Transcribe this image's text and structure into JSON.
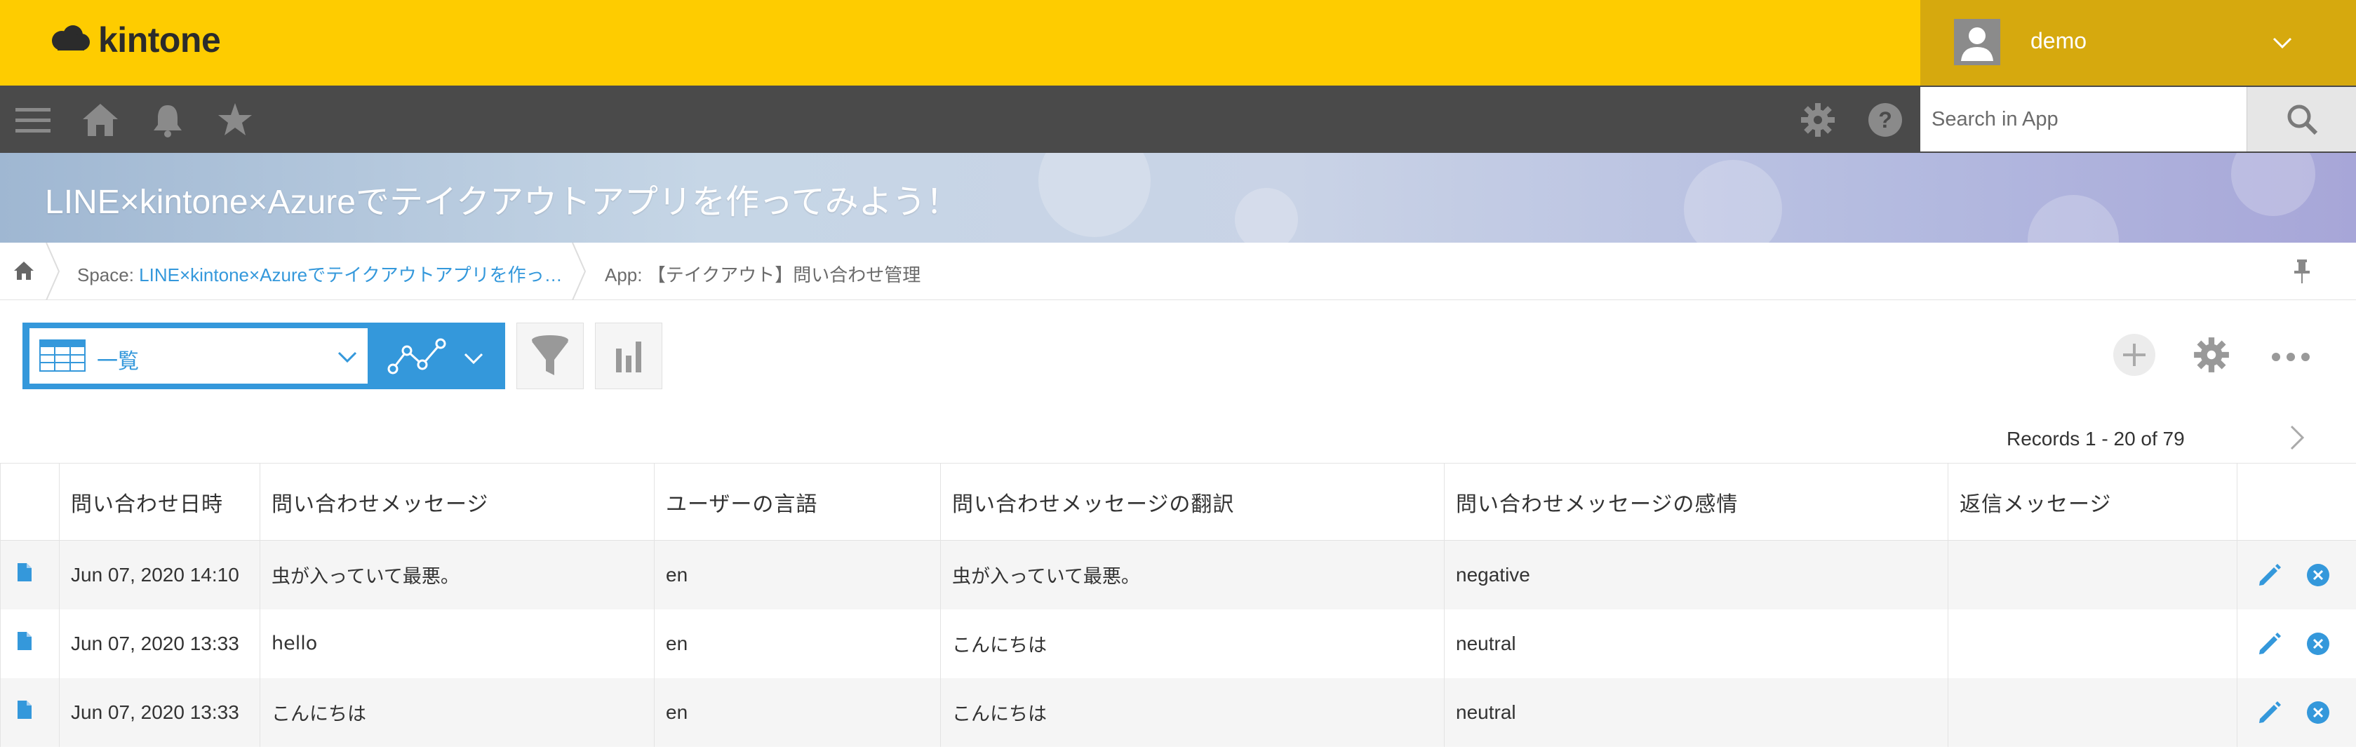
{
  "header": {
    "logo_text": "kintone",
    "user_name": "demo"
  },
  "nav": {
    "search_placeholder": "Search in App"
  },
  "banner": {
    "title": "LINE×kintone×Azureでテイクアウトアプリを作ってみよう！"
  },
  "breadcrumb": {
    "space_prefix": "Space: ",
    "space_name": "LINE×kintone×Azureでテイクアウトアプリを作っ…",
    "app_prefix": "App: ",
    "app_name": "【テイクアウト】問い合わせ管理"
  },
  "toolbar": {
    "view_label": "一覧"
  },
  "pagination": {
    "records_text": "Records 1 - 20 of 79"
  },
  "table": {
    "columns": [
      "問い合わせ日時",
      "問い合わせメッセージ",
      "ユーザーの言語",
      "問い合わせメッセージの翻訳",
      "問い合わせメッセージの感情",
      "返信メッセージ"
    ],
    "rows": [
      [
        "Jun 07, 2020 14:10",
        "虫が入っていて最悪。",
        "en",
        "虫が入っていて最悪。",
        "negative",
        ""
      ],
      [
        "Jun 07, 2020 13:33",
        "hello",
        "en",
        "こんにちは",
        "neutral",
        ""
      ],
      [
        "Jun 07, 2020 13:33",
        "こんにちは",
        "en",
        "こんにちは",
        "neutral",
        ""
      ]
    ]
  },
  "colors": {
    "header_yellow": "#fecc00",
    "user_area": "#d6a90e",
    "nav_dark": "#4a4a4a",
    "accent_blue": "#3498db",
    "row_stripe": "#f5f5f5"
  },
  "icons": [
    "menu-icon",
    "home-icon",
    "bell-icon",
    "star-icon",
    "gear-icon",
    "help-icon",
    "search-icon",
    "pin-icon",
    "table-view-icon",
    "graph-icon",
    "filter-icon",
    "bar-chart-icon",
    "add-icon",
    "settings-icon",
    "more-icon",
    "document-icon",
    "edit-icon",
    "delete-icon"
  ]
}
